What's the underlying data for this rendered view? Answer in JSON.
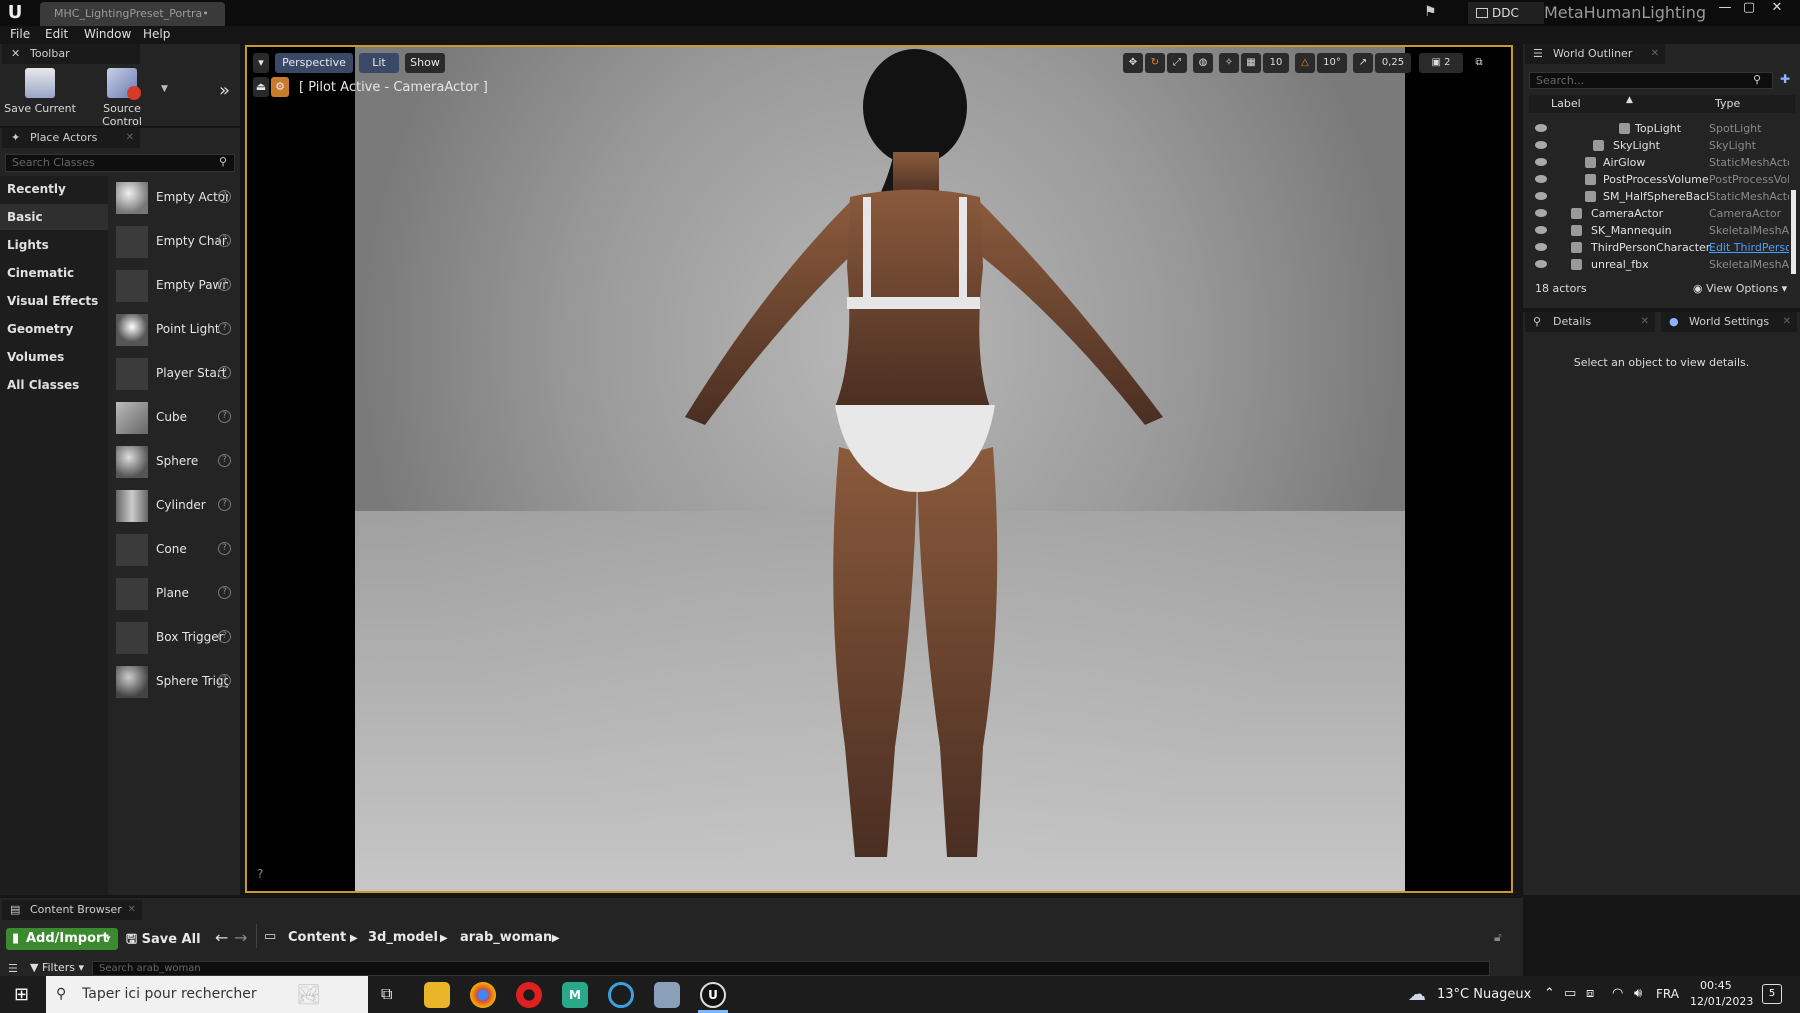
{
  "window": {
    "doc_tab": "MHC_LightingPreset_Portra•",
    "ddc_label": "DDC",
    "project_name": "MetaHumanLighting",
    "min": "—",
    "max": "▢",
    "close": "✕"
  },
  "menu": {
    "file": "File",
    "edit": "Edit",
    "window": "Window",
    "help": "Help"
  },
  "toolbar": {
    "tab": "Toolbar",
    "save_current": "Save Current",
    "source_control": "Source Control"
  },
  "place_actors": {
    "tab": "Place Actors",
    "search_placeholder": "Search Classes",
    "categories": [
      "Recently Placed",
      "Basic",
      "Lights",
      "Cinematic",
      "Visual Effects",
      "Geometry",
      "Volumes",
      "All Classes"
    ],
    "actors": [
      "Empty Actor",
      "Empty Character",
      "Empty Pawn",
      "Point Light",
      "Player Start",
      "Cube",
      "Sphere",
      "Cylinder",
      "Cone",
      "Plane",
      "Box Trigger",
      "Sphere Trigger"
    ]
  },
  "viewport": {
    "perspective": "Perspective",
    "lit": "Lit",
    "show": "Show",
    "pilot": "[ Pilot Active - CameraActor ]",
    "grid_snap": "10",
    "rot_snap": "10°",
    "scale_snap": "0,25",
    "cam_speed": "2"
  },
  "outliner": {
    "tab": "World Outliner",
    "search_placeholder": "Search...",
    "col_label": "Label",
    "col_type": "Type",
    "rows": [
      {
        "label": "TopLight",
        "type": "SpotLight"
      },
      {
        "label": "SkyLight",
        "type": "SkyLight"
      },
      {
        "label": "AirGlow",
        "type": "StaticMeshActor"
      },
      {
        "label": "PostProcessVolume",
        "type": "PostProcessVolume"
      },
      {
        "label": "SM_HalfSphereBackground",
        "type": "StaticMeshActor"
      },
      {
        "label": "CameraActor",
        "type": "CameraActor"
      },
      {
        "label": "SK_Mannequin",
        "type": "SkeletalMeshActor"
      },
      {
        "label": "ThirdPersonCharacter",
        "type": "Edit ThirdPersonCharacter"
      },
      {
        "label": "unreal_fbx",
        "type": "SkeletalMeshActor"
      }
    ],
    "actor_count": "18 actors",
    "view_options": "View Options"
  },
  "details": {
    "tab": "Details",
    "world_settings_tab": "World Settings",
    "empty_msg": "Select an object to view details."
  },
  "content_browser": {
    "tab": "Content Browser",
    "add_import": "Add/Import",
    "save_all": "Save All",
    "crumbs": [
      "Content",
      "3d_model",
      "arab_woman"
    ],
    "filters": "Filters",
    "search_placeholder": "Search arab_woman"
  },
  "taskbar": {
    "search_placeholder": "Taper ici pour rechercher",
    "weather": "13°C  Nuageux",
    "lang": "FRA",
    "time": "00:45",
    "date": "12/01/2023",
    "notif_count": "5"
  },
  "colors": {
    "viewport_border": "#c99a2a",
    "add_import_green": "#3b8a2f",
    "link_blue": "#4a9eff"
  }
}
